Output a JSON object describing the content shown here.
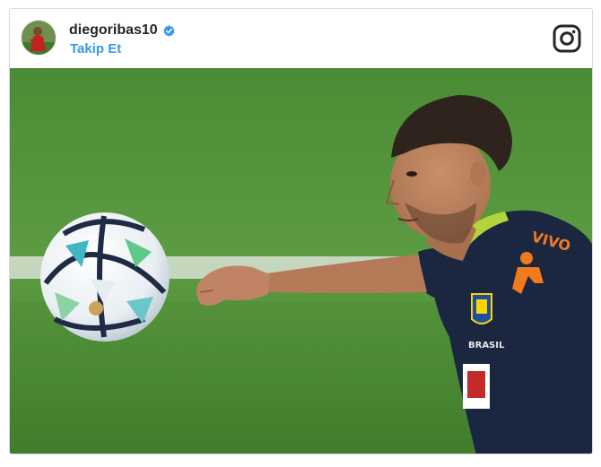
{
  "post": {
    "username": "diegoribas10",
    "follow_label": "Takip Et",
    "verified": true
  },
  "jersey": {
    "sponsor": "VIVO",
    "badge_text": "BRASIL"
  },
  "icons": {
    "verified": "verified-badge-icon",
    "instagram": "instagram-glyph-icon"
  },
  "colors": {
    "follow_blue": "#3897f0",
    "verified_blue": "#3897f0",
    "grass_green": "#4f8f3a",
    "jersey_navy": "#1b2640",
    "jersey_accent": "#f07a1c"
  }
}
